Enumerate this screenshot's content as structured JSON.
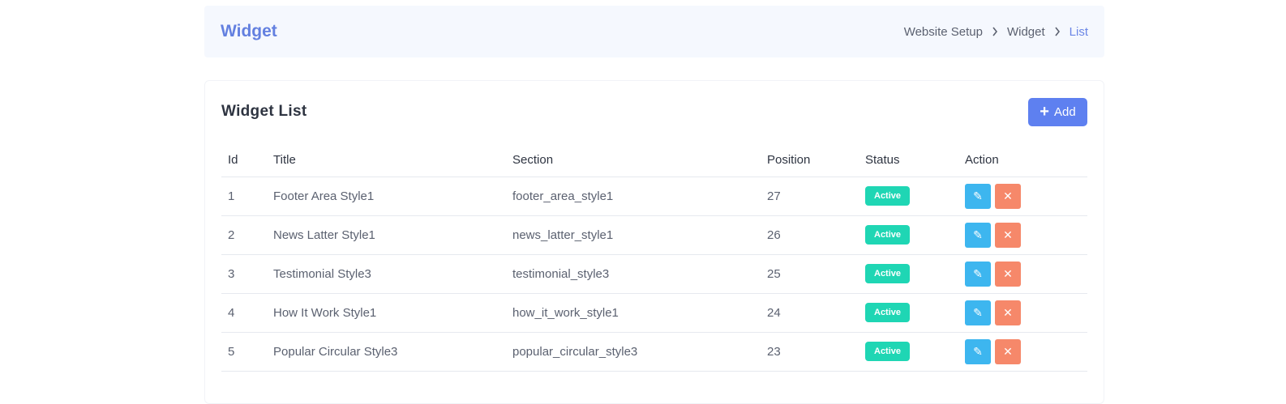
{
  "header": {
    "title": "Widget",
    "breadcrumb": [
      "Website Setup",
      "Widget",
      "List"
    ]
  },
  "card": {
    "title": "Widget List",
    "add_label": "Add"
  },
  "table": {
    "columns": [
      "Id",
      "Title",
      "Section",
      "Position",
      "Status",
      "Action"
    ],
    "rows": [
      {
        "id": "1",
        "title": "Footer Area Style1",
        "section": "footer_area_style1",
        "position": "27",
        "status": "Active"
      },
      {
        "id": "2",
        "title": "News Latter Style1",
        "section": "news_latter_style1",
        "position": "26",
        "status": "Active"
      },
      {
        "id": "3",
        "title": "Testimonial Style3",
        "section": "testimonial_style3",
        "position": "25",
        "status": "Active"
      },
      {
        "id": "4",
        "title": "How It Work Style1",
        "section": "how_it_work_style1",
        "position": "24",
        "status": "Active"
      },
      {
        "id": "5",
        "title": "Popular Circular Style3",
        "section": "popular_circular_style3",
        "position": "23",
        "status": "Active"
      }
    ]
  },
  "colors": {
    "accent": "#5e80f0",
    "status_active": "#1fd6b4",
    "edit": "#3db6ef",
    "delete": "#f6886a"
  },
  "icons": {
    "add": "plus-icon",
    "edit": "pencil-icon",
    "delete": "close-icon",
    "breadcrumb_sep": "chevron-right-icon"
  }
}
